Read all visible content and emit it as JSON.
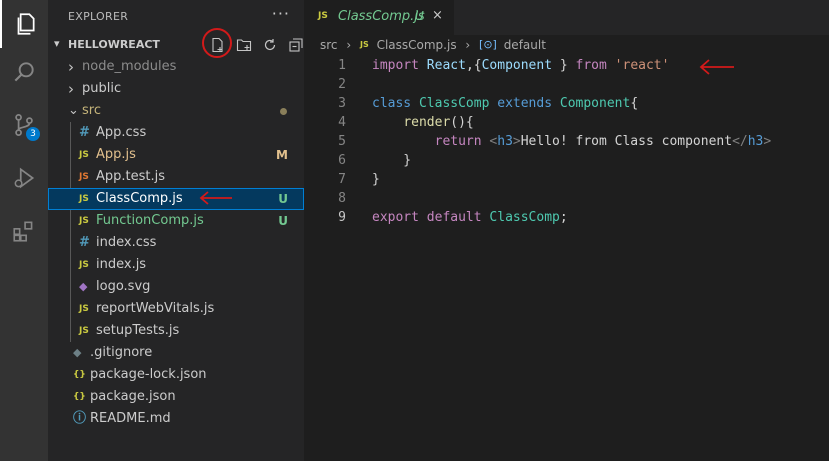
{
  "activity_bar": {
    "items": [
      {
        "icon": "files-icon",
        "active": true
      },
      {
        "icon": "search-icon"
      },
      {
        "icon": "source-control-icon",
        "badge": "3"
      },
      {
        "icon": "run-debug-icon"
      },
      {
        "icon": "extensions-icon"
      }
    ]
  },
  "sidebar": {
    "title": "EXPLORER",
    "more": "···",
    "project": "HELLOWREACT",
    "actions": [
      "new-file-icon",
      "new-folder-icon",
      "refresh-icon",
      "collapse-all-icon"
    ],
    "tree": [
      {
        "name": "node_modules",
        "type": "folder",
        "expanded": false,
        "depth": 0,
        "color": "#8c8c8c"
      },
      {
        "name": "public",
        "type": "folder",
        "expanded": false,
        "depth": 0,
        "color": "#cccccc"
      },
      {
        "name": "src",
        "type": "folder",
        "expanded": true,
        "depth": 0,
        "color": "#c5b47a",
        "modified_dot": true
      },
      {
        "name": "App.css",
        "type": "css",
        "depth": 1,
        "color": "#cccccc"
      },
      {
        "name": "App.js",
        "type": "js",
        "depth": 1,
        "color": "#e2c08d",
        "status": "M",
        "status_color": "#e2c08d"
      },
      {
        "name": "App.test.js",
        "type": "test",
        "depth": 1,
        "color": "#cccccc"
      },
      {
        "name": "ClassComp.js",
        "type": "js",
        "depth": 1,
        "color": "#ffffff",
        "status": "U",
        "status_color": "#73c991",
        "selected": true
      },
      {
        "name": "FunctionComp.js",
        "type": "js",
        "depth": 1,
        "color": "#73c991",
        "status": "U",
        "status_color": "#73c991"
      },
      {
        "name": "index.css",
        "type": "css",
        "depth": 1,
        "color": "#cccccc"
      },
      {
        "name": "index.js",
        "type": "js",
        "depth": 1,
        "color": "#cccccc"
      },
      {
        "name": "logo.svg",
        "type": "svg",
        "depth": 1,
        "color": "#cccccc"
      },
      {
        "name": "reportWebVitals.js",
        "type": "js",
        "depth": 1,
        "color": "#cccccc"
      },
      {
        "name": "setupTests.js",
        "type": "js",
        "depth": 1,
        "color": "#cccccc"
      },
      {
        "name": ".gitignore",
        "type": "git",
        "depth": 0,
        "color": "#cccccc"
      },
      {
        "name": "package-lock.json",
        "type": "json",
        "depth": 0,
        "color": "#cccccc"
      },
      {
        "name": "package.json",
        "type": "json",
        "depth": 0,
        "color": "#cccccc"
      },
      {
        "name": "README.md",
        "type": "info",
        "depth": 0,
        "color": "#cccccc"
      }
    ]
  },
  "editor": {
    "tab": {
      "lang": "JS",
      "name": "ClassComp.js",
      "status": "U",
      "close": "×"
    },
    "breadcrumb": {
      "folder": "src",
      "file_lang": "JS",
      "file": "ClassComp.js",
      "symbol": "default"
    },
    "lines": [
      {
        "n": "1",
        "tokens": [
          [
            "import",
            "ctl"
          ],
          [
            " ",
            "p"
          ],
          [
            "React",
            "var"
          ],
          [
            ",{",
            "p"
          ],
          [
            "Component",
            "var"
          ],
          [
            " } ",
            "p"
          ],
          [
            "from",
            "ctl"
          ],
          [
            " ",
            "p"
          ],
          [
            "'react'",
            "str"
          ]
        ]
      },
      {
        "n": "2",
        "tokens": []
      },
      {
        "n": "3",
        "tokens": [
          [
            "class",
            "kw"
          ],
          [
            " ",
            "p"
          ],
          [
            "ClassComp",
            "cls"
          ],
          [
            " ",
            "p"
          ],
          [
            "extends",
            "kw"
          ],
          [
            " ",
            "p"
          ],
          [
            "Component",
            "cls"
          ],
          [
            "{",
            "p"
          ]
        ]
      },
      {
        "n": "4",
        "tokens": [
          [
            "    ",
            "p"
          ],
          [
            "render",
            "fn"
          ],
          [
            "(){",
            "p"
          ]
        ]
      },
      {
        "n": "5",
        "tokens": [
          [
            "        ",
            "p"
          ],
          [
            "return",
            "ctl"
          ],
          [
            " ",
            "p"
          ],
          [
            "<",
            "brk"
          ],
          [
            "h3",
            "tag"
          ],
          [
            ">",
            "brk"
          ],
          [
            "Hello! from Class component",
            "p"
          ],
          [
            "</",
            "brk"
          ],
          [
            "h3",
            "tag"
          ],
          [
            ">",
            "brk"
          ]
        ]
      },
      {
        "n": "6",
        "tokens": [
          [
            "    }",
            "p"
          ]
        ]
      },
      {
        "n": "7",
        "tokens": [
          [
            "}",
            "p"
          ]
        ]
      },
      {
        "n": "8",
        "tokens": []
      },
      {
        "n": "9",
        "tokens": [
          [
            "export",
            "ctl"
          ],
          [
            " ",
            "p"
          ],
          [
            "default",
            "ctl"
          ],
          [
            " ",
            "p"
          ],
          [
            "ClassComp",
            "cls"
          ],
          [
            ";",
            "p"
          ]
        ],
        "current": true
      }
    ]
  },
  "annotations": {
    "color": "#d21a1a"
  }
}
